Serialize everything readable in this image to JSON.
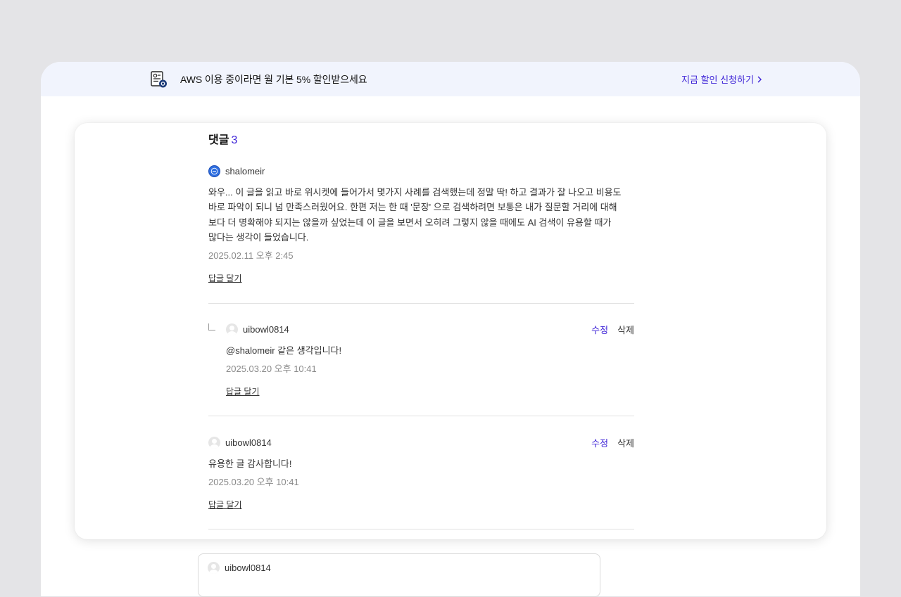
{
  "banner": {
    "icon": "coupon-document-icon",
    "text": "AWS 이용 중이라면 월 기본 5% 할인받으세요",
    "link_label": "지금 할인 신청하기",
    "link_icon": "chevron-right-icon",
    "background": "#f1f4fd",
    "accent": "#3a1fd6"
  },
  "comments_section": {
    "heading": "댓글",
    "count": "3",
    "items": [
      {
        "author": "shalomeir",
        "avatar": "profile-image",
        "text": "와우... 이 글을 읽고 바로 위시켓에 들어가서 몇가지 사례를 검색했는데 정말 딱! 하고 결과가 잘 나오고 비용도 바로 파악이 되니 넘 만족스러웠어요. 한편 저는 한 때 '문장' 으로 검색하려면 보통은 내가 질문할 거리에 대해 보다 더 명확해야 되지는 않을까 싶었는데 이 글을 보면서 오히려 그렇지 않을 때에도 AI 검색이 유용할 때가 많다는 생각이 들었습니다.",
        "date": "2025.02.11 오후 2:45",
        "reply_label": "답글 달기"
      },
      {
        "author": "uibowl0814",
        "avatar": "default-avatar",
        "is_reply": true,
        "text": "@shalomeir 같은 생각입니다!",
        "date": "2025.03.20 오후 10:41",
        "reply_label": "답글 달기",
        "edit_label": "수정",
        "delete_label": "삭제"
      },
      {
        "author": "uibowl0814",
        "avatar": "default-avatar",
        "text": "유용한 글 감사합니다!",
        "date": "2025.03.20 오후 10:41",
        "reply_label": "답글 달기",
        "edit_label": "수정",
        "delete_label": "삭제"
      }
    ]
  },
  "comment_input": {
    "author": "uibowl0814"
  }
}
